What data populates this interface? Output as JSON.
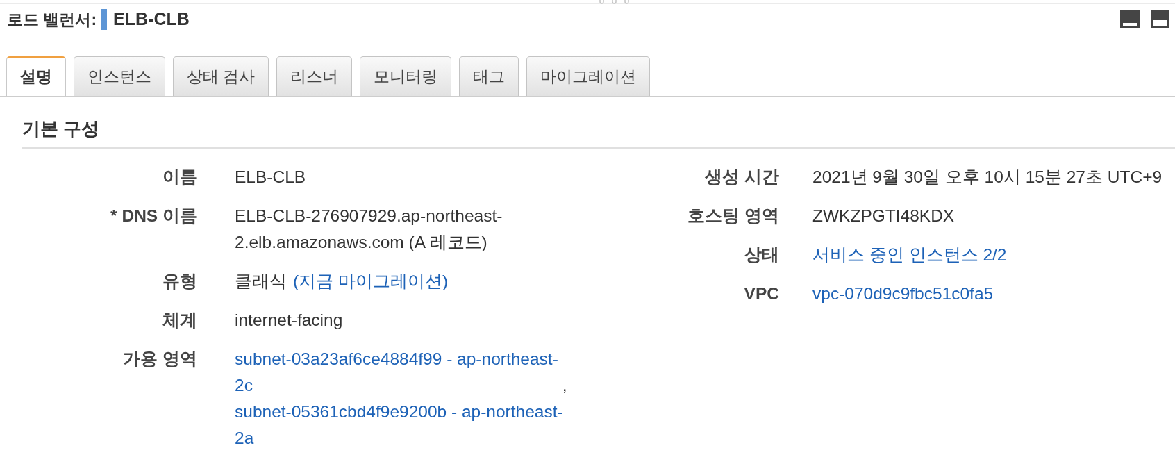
{
  "header": {
    "label": "로드 밸런서:",
    "name": "ELB-CLB"
  },
  "tabs": [
    {
      "label": "설명",
      "selected": true
    },
    {
      "label": "인스턴스",
      "selected": false
    },
    {
      "label": "상태 검사",
      "selected": false
    },
    {
      "label": "리스너",
      "selected": false
    },
    {
      "label": "모니터링",
      "selected": false
    },
    {
      "label": "태그",
      "selected": false
    },
    {
      "label": "마이그레이션",
      "selected": false
    }
  ],
  "section": {
    "title": "기본 구성"
  },
  "left_fields": [
    {
      "kind": "text",
      "label": "이름",
      "value": "ELB-CLB"
    },
    {
      "kind": "text",
      "label": "* DNS 이름",
      "value": [
        "ELB-CLB-276907929.ap-northeast-",
        "2.elb.amazonaws.com (A 레코드)"
      ]
    },
    {
      "kind": "text_link",
      "label": "유형",
      "value": "클래식",
      "link": "(지금 마이그레이션)"
    },
    {
      "kind": "text",
      "label": "체계",
      "value": "internet-facing"
    },
    {
      "kind": "link_list",
      "label": "가용 영역",
      "separator": ",",
      "links": [
        [
          "subnet-03a23af6ce4884f99 - ap-northeast-",
          "2c"
        ],
        [
          "subnet-05361cbd4f9e9200b - ap-northeast-",
          "2a"
        ]
      ]
    }
  ],
  "right_fields": [
    {
      "kind": "text",
      "label": "생성 시간",
      "value": "2021년 9월 30일 오후 10시 15분 27초 UTC+9"
    },
    {
      "kind": "text",
      "label": "호스팅 영역",
      "value": "ZWKZPGTI48KDX"
    },
    {
      "kind": "link",
      "label": "상태",
      "value": "서비스 중인 인스턴스 2/2"
    },
    {
      "kind": "link",
      "label": "VPC",
      "value": "vpc-070d9c9fbc51c0fa5"
    }
  ]
}
